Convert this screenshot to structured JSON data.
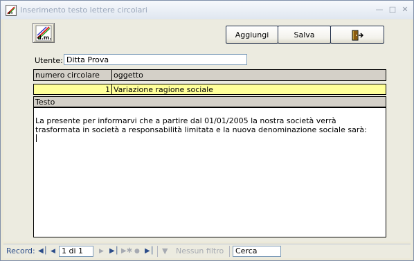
{
  "window": {
    "title": "Inserimento testo lettere circolari"
  },
  "toolbar": {
    "aggiungi": "Aggiungi",
    "salva": "Salva",
    "logo_text": "d.m."
  },
  "form": {
    "utente_label": "Utente:",
    "utente_value": "Ditta Prova",
    "col_numero": "numero circolare",
    "col_oggetto": "oggetto",
    "row_numero": "1",
    "row_oggetto": "Variazione ragione sociale",
    "testo_label": "Testo",
    "testo_line1": "La presente per informarvi che a partire dal  01/01/2005 la nostra società verrà",
    "testo_line2": "trasformata in società a responsabilità limitata e la nuova denominazione sociale sarà:"
  },
  "navigation": {
    "record_label": "Record:",
    "record_value": "1 di 1",
    "filter_label": "Nessun filtro",
    "search_label": "Cerca"
  },
  "colors": {
    "row_highlight": "#ffff99",
    "header_bg": "#d4d0c8",
    "accent": "#2c4d8a"
  },
  "icons": [
    "app-icon",
    "minimize-icon",
    "maximize-icon",
    "close-icon",
    "exit-door-icon",
    "first-record-icon",
    "previous-record-icon",
    "next-record-icon",
    "last-record-icon",
    "new-record-icon",
    "filter-icon"
  ]
}
